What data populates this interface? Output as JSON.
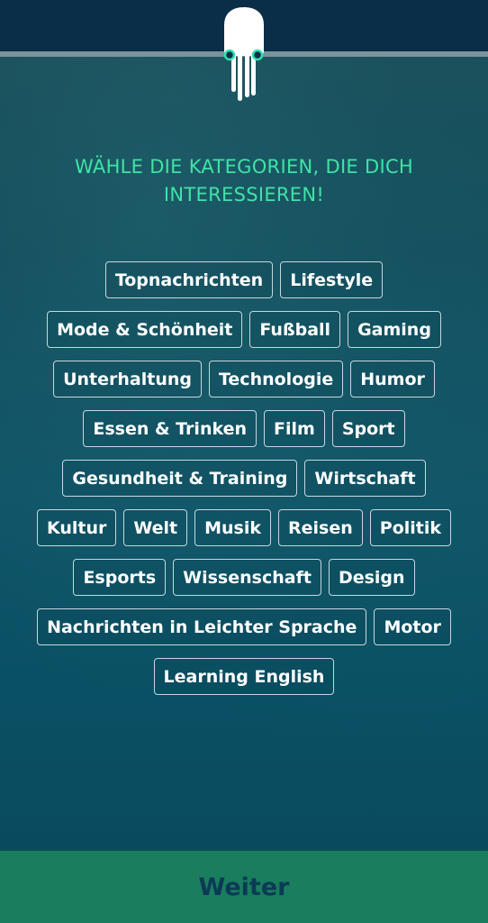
{
  "header": {
    "logo": "octopus-logo-icon"
  },
  "title": "WÄHLE DIE KATEGORIEN, DIE DICH INTERESSIEREN!",
  "categories": {
    "rows": [
      [
        "Topnachrichten",
        "Lifestyle"
      ],
      [
        "Mode & Schönheit",
        "Fußball",
        "Gaming"
      ],
      [
        "Unterhaltung",
        "Technologie",
        "Humor"
      ],
      [
        "Essen & Trinken",
        "Film",
        "Sport"
      ],
      [
        "Gesundheit & Training",
        "Wirtschaft"
      ],
      [
        "Kultur",
        "Welt",
        "Musik",
        "Reisen",
        "Politik"
      ],
      [
        "Esports",
        "Wissenschaft",
        "Design"
      ],
      [
        "Nachrichten in Leichter Sprache",
        "Motor"
      ],
      [
        "Learning English"
      ]
    ]
  },
  "footer": {
    "continue_label": "Weiter"
  },
  "colors": {
    "accent": "#3fe3a6",
    "header_bg": "#0b2e48",
    "footer_bg": "#1a7d5e",
    "footer_text": "#0b3a55"
  }
}
